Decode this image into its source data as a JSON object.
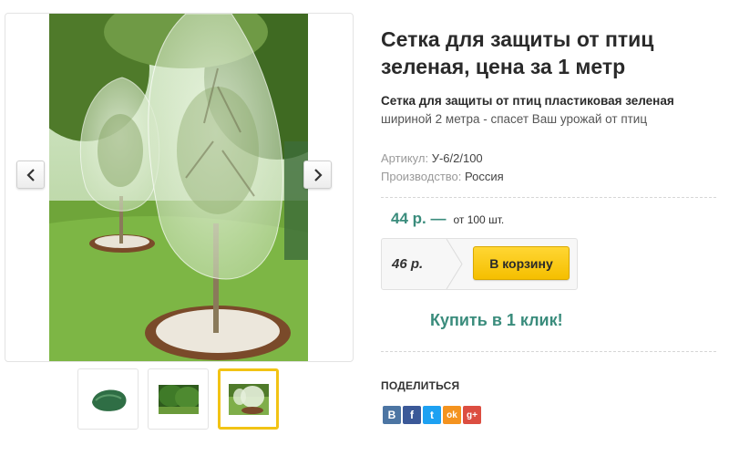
{
  "gallery": {
    "prev_glyph": "‹",
    "next_glyph": "›",
    "thumbnails": [
      {
        "name": "green-net-rolled"
      },
      {
        "name": "tree-in-garden"
      },
      {
        "name": "trees-covered-with-net",
        "active": true
      }
    ]
  },
  "product": {
    "title": "Сетка для защиты от птиц зеленая, цена за 1 метр",
    "desc_bold": "Сетка для защиты от птиц пластиковая зеленая",
    "desc_rest": "шириной 2 метра - спасет Ваш урожай от птиц",
    "sku_label": "Артикул:",
    "sku_value": "У-6/2/100",
    "origin_label": "Производство:",
    "origin_value": "Россия"
  },
  "pricing": {
    "bulk_price": "44 р. —",
    "bulk_note": "от 100 шт.",
    "unit_price": "46 р.",
    "cart_button": "В корзину",
    "one_click": "Купить в 1 клик!"
  },
  "share": {
    "label": "ПОДЕЛИТЬСЯ",
    "buttons": [
      {
        "name": "vk-icon",
        "glyph": "В",
        "color": "#4c75a3"
      },
      {
        "name": "facebook-icon",
        "glyph": "f",
        "color": "#3b5998"
      },
      {
        "name": "twitter-icon",
        "glyph": "t",
        "color": "#1da1f2"
      },
      {
        "name": "odnoklassniki-icon",
        "glyph": "ok",
        "color": "#f4931f"
      },
      {
        "name": "google-plus-icon",
        "glyph": "g+",
        "color": "#dc4e41"
      }
    ]
  },
  "colors": {
    "accent_green": "#3a8c7c",
    "button_yellow": "#f5c400",
    "active_thumb_border": "#f2c314"
  }
}
